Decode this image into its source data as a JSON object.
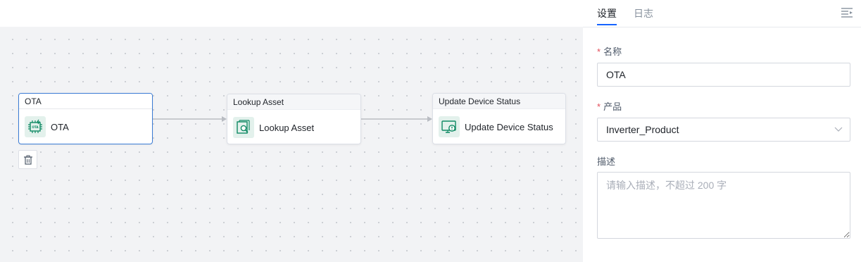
{
  "canvas": {
    "nodes": [
      {
        "header": "OTA",
        "label": "OTA",
        "icon": "chip-ota-icon",
        "selected": true
      },
      {
        "header": "Lookup Asset",
        "label": "Lookup Asset",
        "icon": "asset-search-icon",
        "selected": false
      },
      {
        "header": "Update Device Status",
        "label": "Update Device Status",
        "icon": "monitor-status-icon",
        "selected": false
      }
    ],
    "delete_icon": "trash-icon"
  },
  "panel": {
    "tabs": [
      {
        "label": "设置",
        "active": true
      },
      {
        "label": "日志",
        "active": false
      }
    ],
    "collapse_icon": "collapse-panel-icon",
    "fields": {
      "name": {
        "label": "名称",
        "required_mark": "*",
        "value": "OTA"
      },
      "product": {
        "label": "产品",
        "required_mark": "*",
        "value": "Inverter_Product"
      },
      "description": {
        "label": "描述",
        "value": "",
        "placeholder": "请输入描述，不超过 200 字"
      }
    }
  },
  "colors": {
    "accent": "#1664ff",
    "selected_border": "#3a7bd5",
    "icon_bg": "#e3f1ec",
    "icon_fg": "#0f8a64",
    "required": "#e34d59",
    "canvas_bg": "#f2f3f5"
  }
}
